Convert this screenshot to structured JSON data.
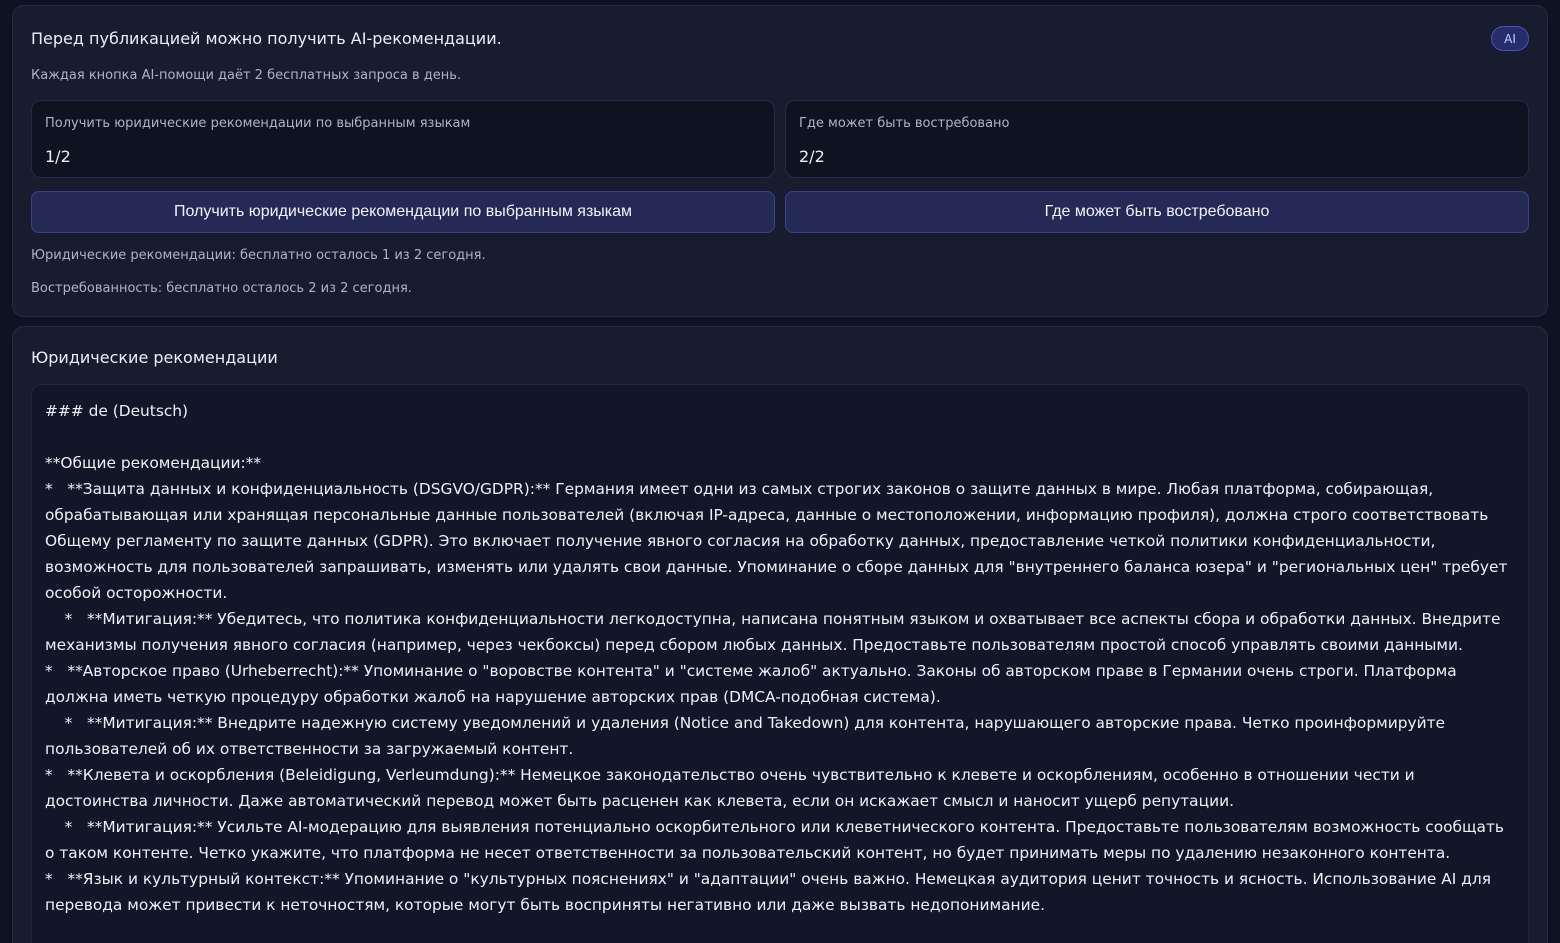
{
  "ai_panel": {
    "title": "Перед публикацией можно получить AI-рекомендации.",
    "badge": "AI",
    "subtitle": "Каждая кнопка AI-помощи даёт 2 бесплатных запроса в день.",
    "counters": [
      {
        "label": "Получить юридические рекомендации по выбранным языкам",
        "value": "1/2"
      },
      {
        "label": "Где может быть востребовано",
        "value": "2/2"
      }
    ],
    "buttons": {
      "legal": "Получить юридические рекомендации по выбранным языкам",
      "demand": "Где может быть востребовано"
    },
    "status_legal": "Юридические рекомендации: бесплатно осталось 1 из 2 сегодня.",
    "status_demand": "Востребованность: бесплатно осталось 2 из 2 сегодня."
  },
  "legal_panel": {
    "title": "Юридические рекомендации",
    "content": "### de (Deutsch)\n\n**Общие рекомендации:**\n*   **Защита данных и конфиденциальность (DSGVO/GDPR):** Германия имеет одни из самых строгих законов о защите данных в мире. Любая платформа, собирающая, обрабатывающая или хранящая персональные данные пользователей (включая IP-адреса, данные о местоположении, информацию профиля), должна строго соответствовать Общему регламенту по защите данных (GDPR). Это включает получение явного согласия на обработку данных, предоставление четкой политики конфиденциальности, возможность для пользователей запрашивать, изменять или удалять свои данные. Упоминание о сборе данных для \"внутреннего баланса юзера\" и \"региональных цен\" требует особой осторожности.\n    *   **Митигация:** Убедитесь, что политика конфиденциальности легкодоступна, написана понятным языком и охватывает все аспекты сбора и обработки данных. Внедрите механизмы получения явного согласия (например, через чекбоксы) перед сбором любых данных. Предоставьте пользователям простой способ управлять своими данными.\n*   **Авторское право (Urheberrecht):** Упоминание о \"воровстве контента\" и \"системе жалоб\" актуально. Законы об авторском праве в Германии очень строги. Платформа должна иметь четкую процедуру обработки жалоб на нарушение авторских прав (DMCA-подобная система).\n    *   **Митигация:** Внедрите надежную систему уведомлений и удаления (Notice and Takedown) для контента, нарушающего авторские права. Четко проинформируйте пользователей об их ответственности за загружаемый контент.\n*   **Клевета и оскорбления (Beleidigung, Verleumdung):** Немецкое законодательство очень чувствительно к клевете и оскорблениям, особенно в отношении чести и достоинства личности. Даже автоматический перевод может быть расценен как клевета, если он искажает смысл и наносит ущерб репутации.\n    *   **Митигация:** Усильте AI-модерацию для выявления потенциально оскорбительного или клеветнического контента. Предоставьте пользователям возможность сообщать о таком контенте. Четко укажите, что платформа не несет ответственности за пользовательский контент, но будет принимать меры по удалению незаконного контента.\n*   **Язык и культурный контекст:** Упоминание о \"культурных пояснениях\" и \"адаптации\" очень важно. Немецкая аудитория ценит точность и ясность. Использование AI для перевода может привести к неточностям, которые могут быть восприняты негативно или даже вызвать недопонимание."
  }
}
